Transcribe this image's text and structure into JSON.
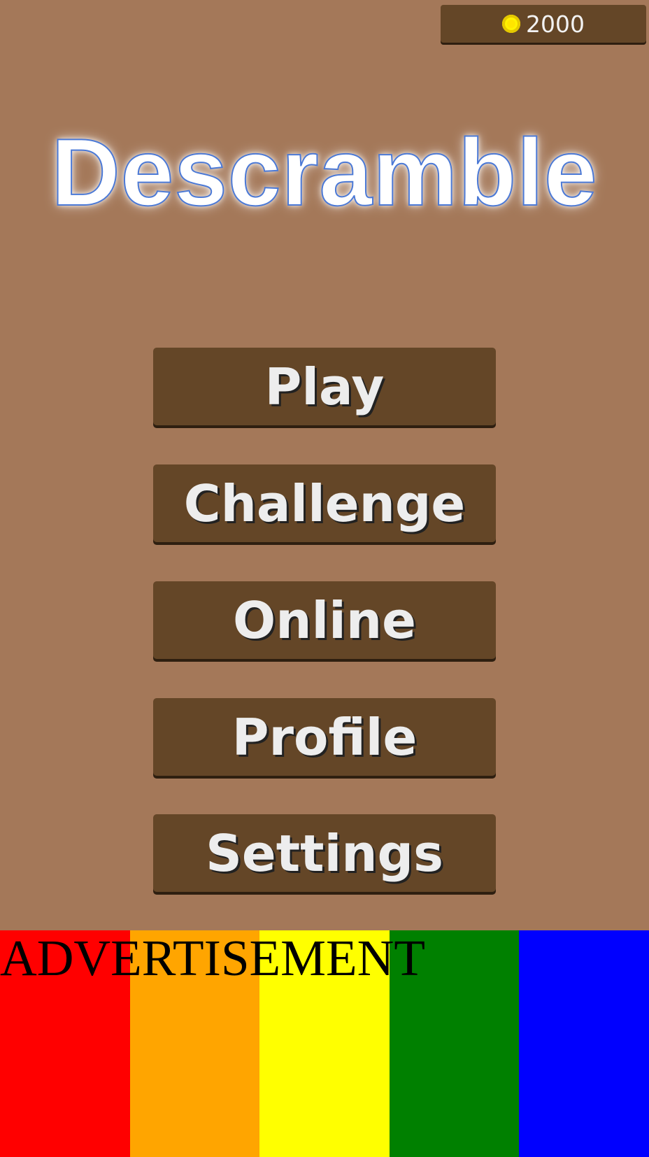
{
  "coins": {
    "icon": "coin-icon",
    "value": "2000"
  },
  "title": "Descramble",
  "menu": {
    "play_label": "Play",
    "challenge_label": "Challenge",
    "online_label": "Online",
    "profile_label": "Profile",
    "settings_label": "Settings"
  },
  "advertisement": {
    "label": "ADVERTISEMENT",
    "stripe_colors": [
      "#FF0000",
      "#FFA500",
      "#FFFF00",
      "#008000",
      "#0000FF"
    ]
  },
  "colors": {
    "background": "#A47859",
    "button": "#644627",
    "button_text": "#EDEDED",
    "title_outline": "#4B79D6",
    "coin": "#FFE500"
  }
}
